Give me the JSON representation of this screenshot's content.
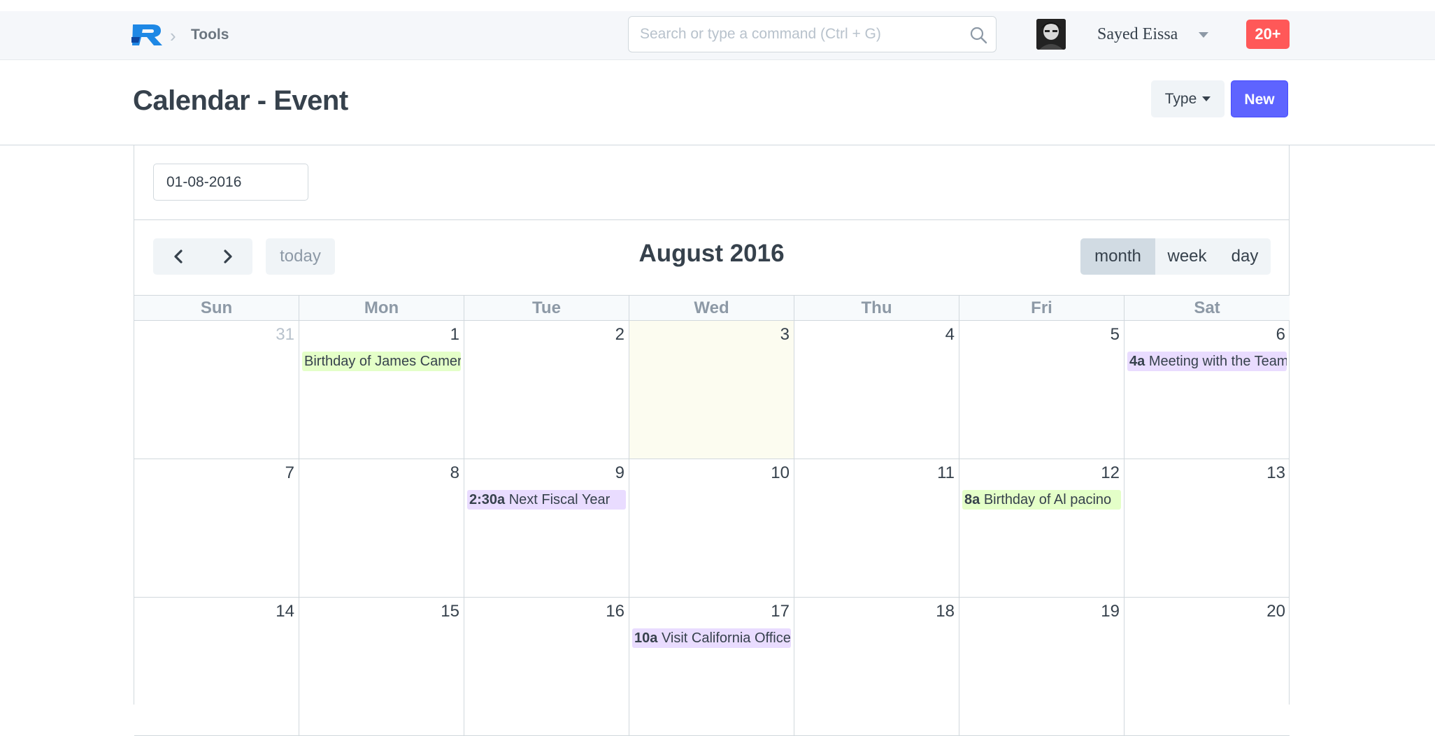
{
  "topbar": {
    "breadcrumb": "Tools",
    "search_placeholder": "Search or type a command (Ctrl + G)",
    "user_name": "Sayed Eissa",
    "notification_badge": "20+"
  },
  "page": {
    "title": "Calendar - Event",
    "type_label": "Type",
    "new_label": "New"
  },
  "filter": {
    "date_value": "01-08-2016"
  },
  "calendar": {
    "title": "August 2016",
    "today_label": "today",
    "views": [
      {
        "label": "month",
        "active": true
      },
      {
        "label": "week",
        "active": false
      },
      {
        "label": "day",
        "active": false
      }
    ],
    "weekdays": [
      "Sun",
      "Mon",
      "Tue",
      "Wed",
      "Thu",
      "Fri",
      "Sat"
    ],
    "weeks": [
      [
        {
          "num": "31",
          "other": true
        },
        {
          "num": "1",
          "event": {
            "time": "",
            "title": "Birthday of James Cameron",
            "color": "green"
          }
        },
        {
          "num": "2"
        },
        {
          "num": "3",
          "today": true
        },
        {
          "num": "4"
        },
        {
          "num": "5"
        },
        {
          "num": "6",
          "event": {
            "time": "4a",
            "title": "Meeting with the Team",
            "color": "purple"
          }
        }
      ],
      [
        {
          "num": "7"
        },
        {
          "num": "8"
        },
        {
          "num": "9",
          "event": {
            "time": "2:30a",
            "title": "Next Fiscal Year",
            "color": "purple"
          }
        },
        {
          "num": "10"
        },
        {
          "num": "11"
        },
        {
          "num": "12",
          "event": {
            "time": "8a",
            "title": "Birthday of Al pacino",
            "color": "green"
          }
        },
        {
          "num": "13"
        }
      ],
      [
        {
          "num": "14"
        },
        {
          "num": "15"
        },
        {
          "num": "16"
        },
        {
          "num": "17",
          "event": {
            "time": "10a",
            "title": "Visit California Office",
            "color": "purple"
          }
        },
        {
          "num": "18"
        },
        {
          "num": "19"
        },
        {
          "num": "20"
        }
      ]
    ]
  },
  "colors": {
    "primary": "#5e64ff",
    "notification": "#ff5858",
    "event_green": "#e4ffc8",
    "event_purple": "#e9dcff",
    "today_bg": "#fcfcf0"
  }
}
